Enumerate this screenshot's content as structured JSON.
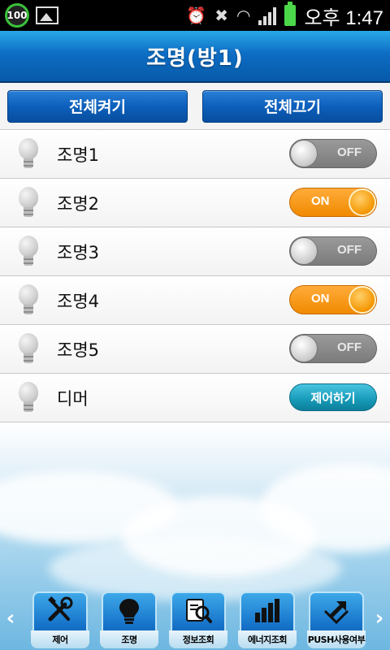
{
  "status_bar": {
    "battery_level": "100",
    "time": "오후 1:47"
  },
  "header": {
    "title": "조명(방1)"
  },
  "actions": {
    "all_on_label": "전체켜기",
    "all_off_label": "전체끄기"
  },
  "lights": [
    {
      "label": "조명1",
      "state": "OFF"
    },
    {
      "label": "조명2",
      "state": "ON"
    },
    {
      "label": "조명3",
      "state": "OFF"
    },
    {
      "label": "조명4",
      "state": "ON"
    },
    {
      "label": "조명5",
      "state": "OFF"
    }
  ],
  "dimmer": {
    "label": "디머",
    "button_label": "제어하기"
  },
  "bottom_nav": {
    "items": [
      {
        "label": "제어",
        "icon": "tools-icon"
      },
      {
        "label": "조명",
        "icon": "lightbulb-icon"
      },
      {
        "label": "정보조회",
        "icon": "document-search-icon"
      },
      {
        "label": "에너지조회",
        "icon": "bar-chart-icon"
      },
      {
        "label": "PUSH사용여부",
        "icon": "push-arrow-icon"
      }
    ],
    "prev": "‹",
    "next": "›"
  },
  "colors": {
    "header_blue": "#0d6dc4",
    "toggle_on": "#f08a00",
    "toggle_off": "#7b7b7b",
    "control_button": "#169ab8"
  }
}
